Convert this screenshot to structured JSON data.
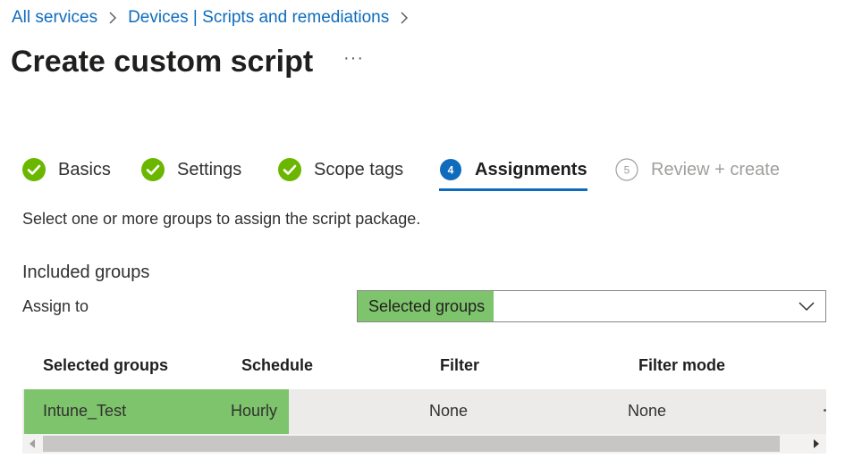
{
  "breadcrumb": {
    "items": [
      "All services",
      "Devices | Scripts and remediations"
    ]
  },
  "page": {
    "title": "Create custom script",
    "more_label": "···"
  },
  "steps": [
    {
      "number": "1",
      "label": "Basics",
      "state": "completed"
    },
    {
      "number": "2",
      "label": "Settings",
      "state": "completed"
    },
    {
      "number": "3",
      "label": "Scope tags",
      "state": "completed"
    },
    {
      "number": "4",
      "label": "Assignments",
      "state": "active"
    },
    {
      "number": "5",
      "label": "Review + create",
      "state": "disabled"
    }
  ],
  "assignments": {
    "instruction": "Select one or more groups to assign the script package.",
    "section_label": "Included groups",
    "assign_to_label": "Assign to",
    "assign_to_value": "Selected groups"
  },
  "table": {
    "columns": [
      "Selected groups",
      "Schedule",
      "Filter",
      "Filter mode"
    ],
    "rows": [
      {
        "group": "Intune_Test",
        "schedule": "Hourly",
        "filter": "None",
        "filter_mode": "None"
      }
    ]
  },
  "colors": {
    "link": "#0f6cbd",
    "success": "#6bb700",
    "accent": "#0f6cbd",
    "highlight": "#7dc46c",
    "disabled": "#a19f9d"
  },
  "icons": {
    "completed": "checkmark-circle-icon",
    "dropdown": "chevron-down-icon",
    "separator": "chevron-right-icon"
  }
}
